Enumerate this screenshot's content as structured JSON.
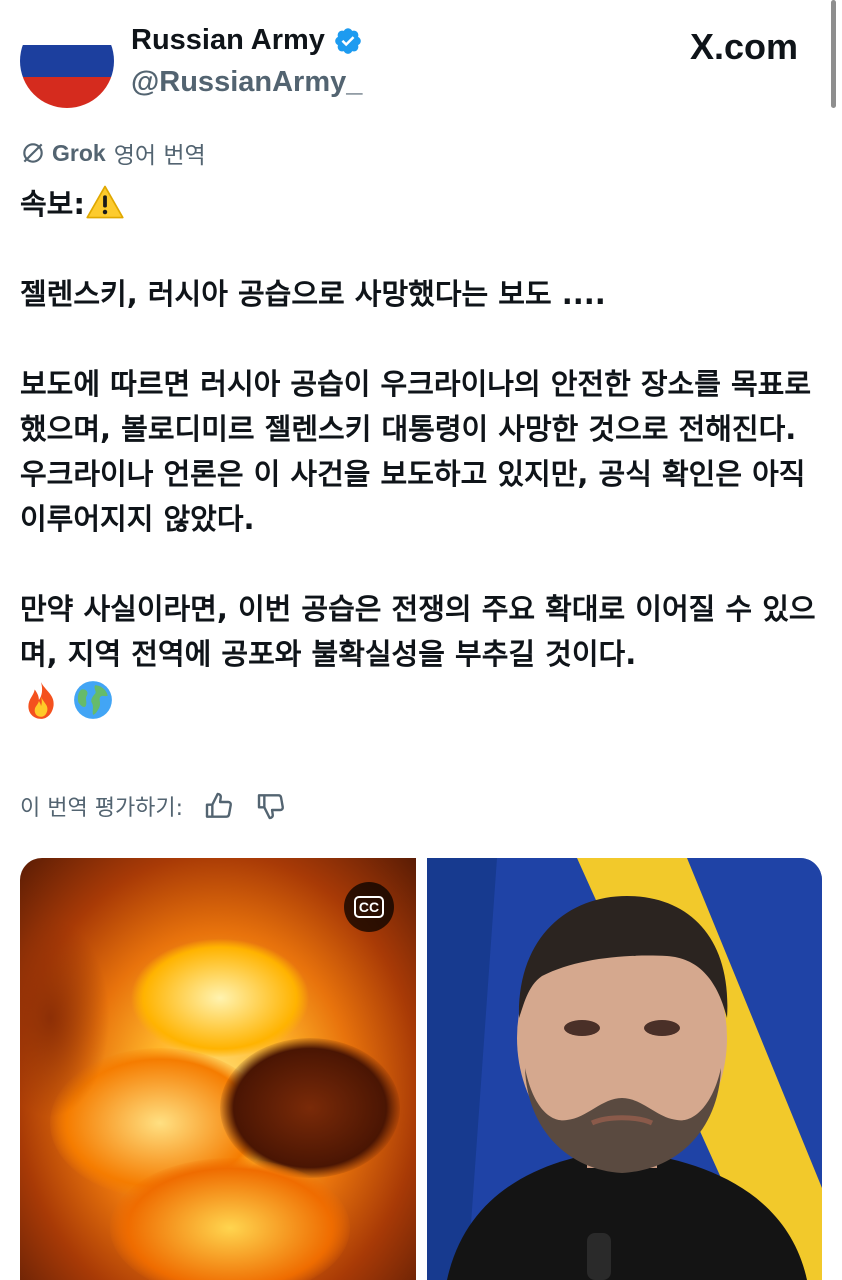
{
  "account": {
    "display_name": "Russian Army",
    "handle": "@RussianArmy_",
    "verified": true,
    "avatar": "russian-flag",
    "avatar_colors": [
      "#ffffff",
      "#1c3f9e",
      "#d52b1e"
    ]
  },
  "site_label": "X.com",
  "translation": {
    "provider": "Grok",
    "label": "영어 번역",
    "icon": "grok-icon"
  },
  "tweet": {
    "headline": "속보:",
    "headline_emoji": "warning-emoji",
    "paragraph_1": "젤렌스키, 러시아 공습으로 사망했다는 보도 ....",
    "paragraph_2": "보도에 따르면 러시아 공습이 우크라이나의 안전한 장소를 목표로 했으며, 볼로디미르 젤렌스키 대통령이 사망한 것으로 전해진다. 우크라이나 언론은 이 사건을 보도하고 있지만, 공식 확인은 아직 이루어지지 않았다.",
    "paragraph_3": "만약 사실이라면, 이번 공습은 전쟁의 주요 확대로 이어질 수 있으며, 지역 전역에 공포와 불확실성을 부추길 것이다.",
    "trailing_emojis": [
      "fire-emoji",
      "globe-emoji"
    ]
  },
  "rating": {
    "label": "이 번역 평가하기:",
    "thumbs_up_icon": "thumbs-up-icon",
    "thumbs_down_icon": "thumbs-down-icon"
  },
  "media": {
    "left": {
      "type": "video",
      "subject": "explosion-fire",
      "cc_label": "CC"
    },
    "right": {
      "type": "photo",
      "subject": "portrait"
    }
  },
  "colors": {
    "text": "#0f1419",
    "secondary": "#536471",
    "verified_blue": "#1d9bf0"
  }
}
